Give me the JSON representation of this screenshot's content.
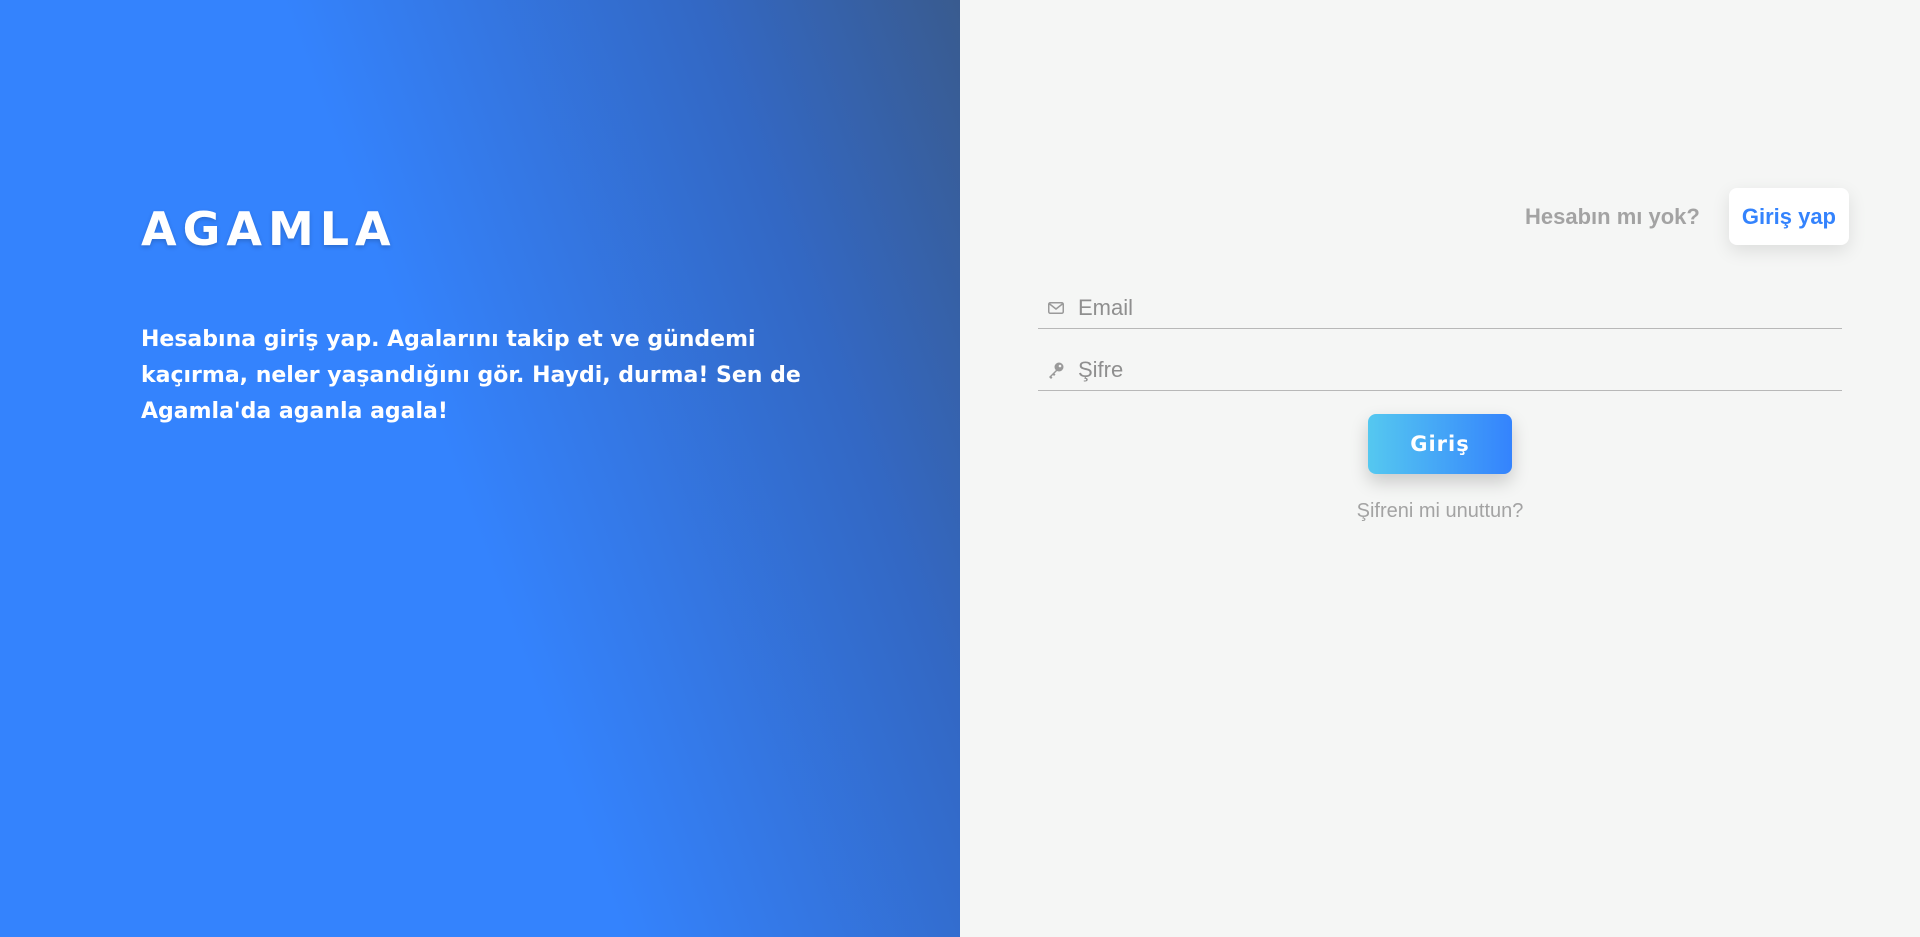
{
  "brand": {
    "name": "AGAMLA",
    "tagline": "Hesabına giriş yap. Agalarını takip et ve gündemi kaçırma, neler yaşandığını gör. Haydi, durma! Sen de Agamla'da aganla agala!"
  },
  "signup": {
    "question": "Hesabın mı yok?",
    "button_label": "Giriş yap"
  },
  "form": {
    "email": {
      "placeholder": "Email",
      "value": "",
      "icon": "envelope-icon"
    },
    "password": {
      "placeholder": "Şifre",
      "value": "",
      "icon": "key-icon"
    },
    "submit_label": "Giriş",
    "forgot_label": "Şifreni mi unuttun?"
  },
  "colors": {
    "accent": "#3483fd",
    "accent_dark": "#395b8f",
    "gradient_light": "#55c8f0",
    "panel_bg": "#f5f6f5",
    "muted_text": "#a3a3a3"
  }
}
